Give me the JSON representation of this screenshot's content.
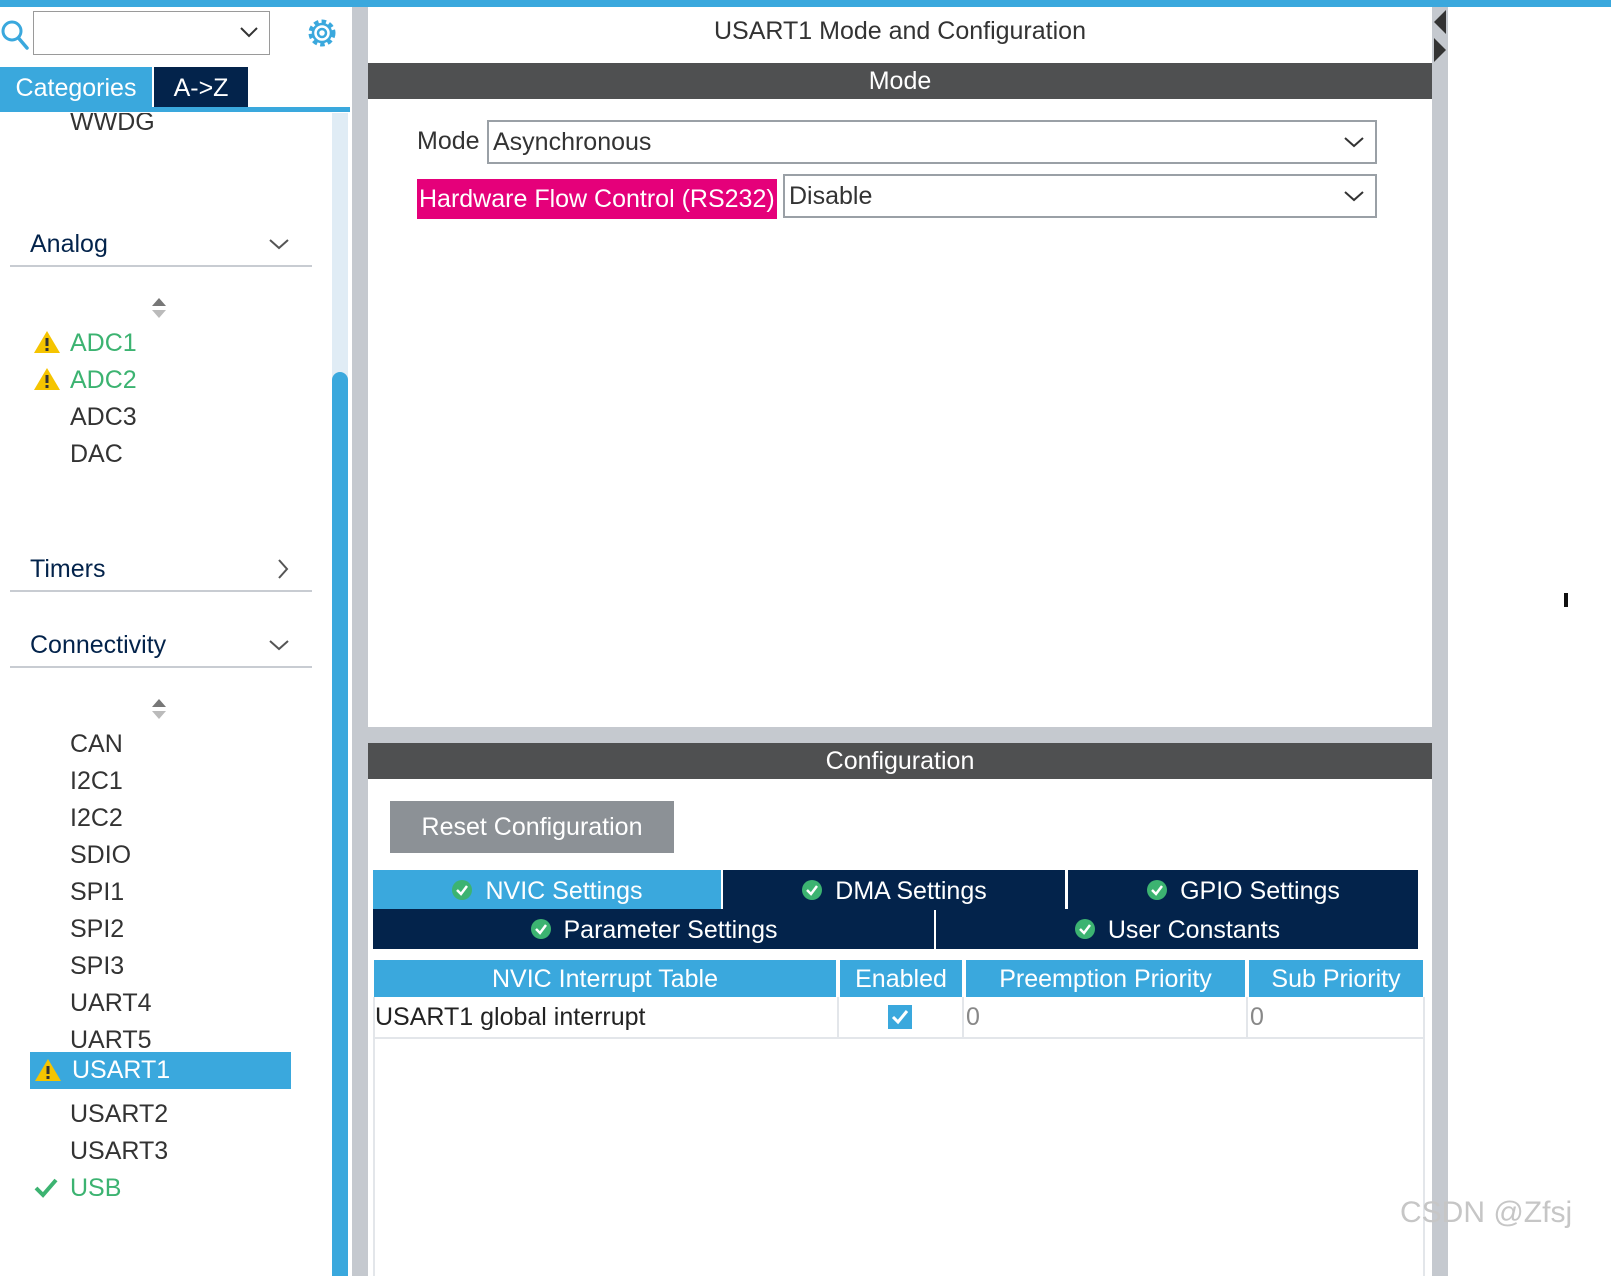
{
  "sidebar": {
    "tabs": {
      "categories": "Categories",
      "az": "A->Z"
    },
    "clipped_item": "WWDG",
    "analog": {
      "label": "Analog",
      "items": [
        "ADC1",
        "ADC2",
        "ADC3",
        "DAC"
      ]
    },
    "timers": {
      "label": "Timers"
    },
    "connectivity": {
      "label": "Connectivity",
      "items": [
        "CAN",
        "I2C1",
        "I2C2",
        "SDIO",
        "SPI1",
        "SPI2",
        "SPI3",
        "UART4",
        "UART5",
        "USART1",
        "USART2",
        "USART3",
        "USB"
      ],
      "selected": "USART1"
    }
  },
  "main": {
    "title": "USART1 Mode and Configuration",
    "mode_section": {
      "header": "Mode",
      "mode_label": "Mode",
      "mode_value": "Asynchronous",
      "hw_flow_label": "Hardware Flow Control (RS232)",
      "hw_flow_value": "Disable"
    },
    "config_section": {
      "header": "Configuration",
      "reset_button": "Reset Configuration",
      "tabs": [
        "NVIC Settings",
        "DMA Settings",
        "GPIO Settings",
        "Parameter Settings",
        "User Constants"
      ],
      "table": {
        "headers": [
          "NVIC Interrupt Table",
          "Enabled",
          "Preemption Priority",
          "Sub Priority"
        ],
        "rows": [
          {
            "name": "USART1 global interrupt",
            "enabled": true,
            "preemption": "0",
            "sub": "0"
          }
        ]
      }
    }
  },
  "watermark": "CSDN @Zfsj",
  "colors": {
    "accent": "#3aa8dd",
    "dark_navy": "#03234b",
    "section_bar": "#4f5051",
    "highlight_pink": "#e5007a",
    "warning": "#f5c400",
    "ok_green": "#3cb371"
  }
}
